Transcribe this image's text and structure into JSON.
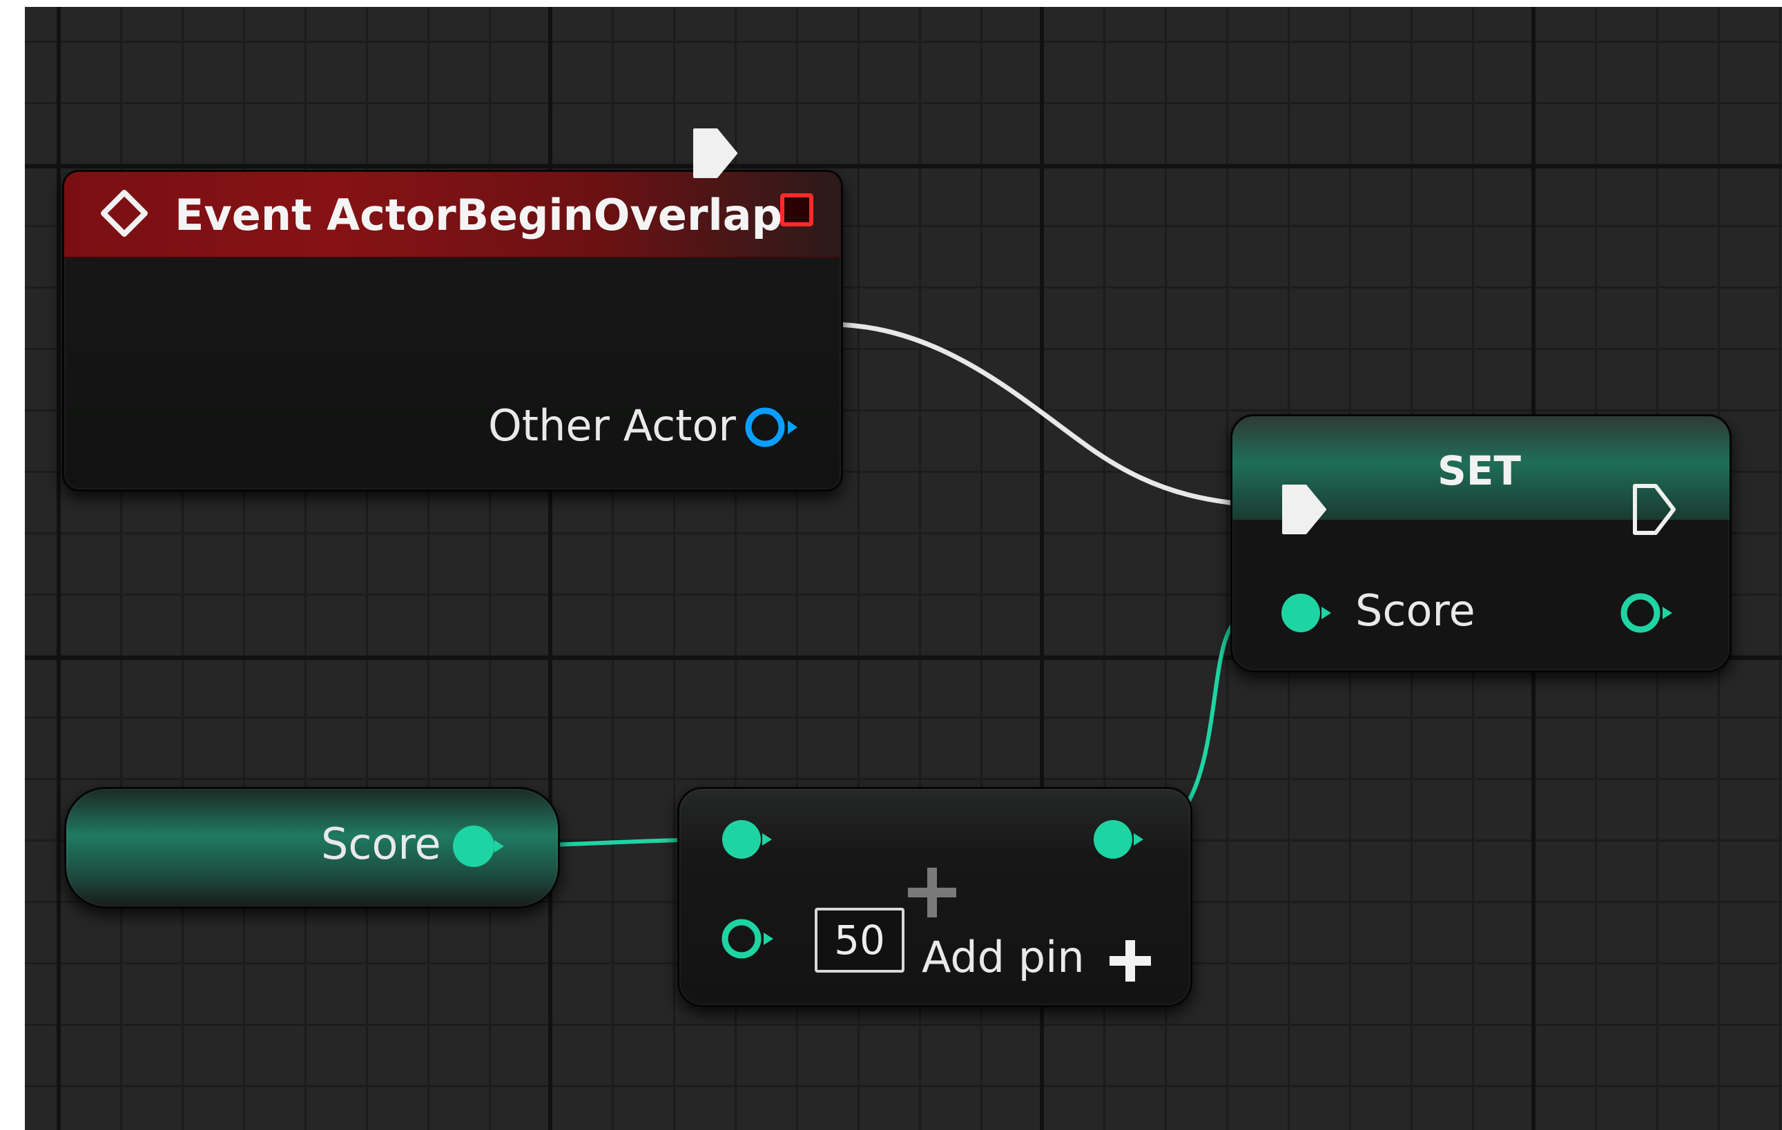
{
  "event_node": {
    "title": "Event ActorBeginOverlap",
    "output_pin_label": "Other Actor",
    "header_color": "#861215",
    "icon": "event-diamond-icon",
    "breakpoint_icon": "breakpoint-square-icon"
  },
  "set_node": {
    "title": "SET",
    "variable_label": "Score",
    "header_color": "#1f6e57"
  },
  "getter_node": {
    "variable_label": "Score",
    "color": "#1f7a61"
  },
  "add_node": {
    "operator_icon": "plus-icon",
    "default_value": "50",
    "add_pin_label": "Add pin",
    "add_pin_icon": "plus-icon"
  },
  "colors": {
    "canvas": "#262626",
    "exec_wire": "#e8e8e8",
    "integer_pin": "#1fd4a3",
    "object_pin": "#0a9fff"
  }
}
